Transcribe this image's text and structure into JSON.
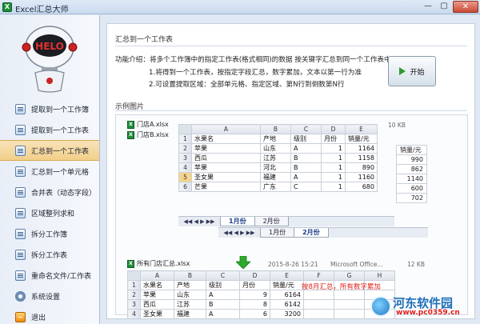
{
  "window": {
    "title": "Excel汇总大师",
    "min_glyph": "—",
    "max_glyph": "▢",
    "close_glyph": "✕"
  },
  "sidebar": {
    "items": [
      {
        "label": "提取到一个工作簿",
        "icon": "workbook-icon"
      },
      {
        "label": "提取到一个工作表",
        "icon": "worksheet-icon"
      },
      {
        "label": "汇总到一个工作表",
        "icon": "summary-sheet-icon",
        "active": true
      },
      {
        "label": "汇总到一个单元格",
        "icon": "cell-icon"
      },
      {
        "label": "合并表（动态字段）",
        "icon": "merge-icon"
      },
      {
        "label": "区域整列求和",
        "icon": "sum-icon"
      },
      {
        "label": "拆分工作簿",
        "icon": "split-workbook-icon"
      },
      {
        "label": "拆分工作表",
        "icon": "split-sheet-icon"
      },
      {
        "label": "重命名文件/工作表",
        "icon": "rename-icon"
      },
      {
        "label": "系统设置",
        "icon": "gear-icon"
      },
      {
        "label": "退出",
        "icon": "exit-icon"
      }
    ]
  },
  "main": {
    "section_title": "汇总到一个工作表",
    "intro": "功能介绍：将多个工作簿中的指定工作表(格式相同)的数据 按关键字汇总到同一个工作表中",
    "bullet1": "1.将得到一个工作表，按指定字段汇总，数字累加，文本以第一行为准",
    "bullet2": "2.可设置提取区域：全部单元格、指定区域、第N行到倒数第N行",
    "start_button": "开始",
    "example_title": "示例图片"
  },
  "example": {
    "file_a": "门店A.xlsx",
    "file_b": "门店B.xlsx",
    "file_a_size": "10 KB",
    "col_letters": [
      "A",
      "B",
      "C",
      "D",
      "E"
    ],
    "sheet_a": {
      "header": [
        "水果名",
        "产地",
        "级别",
        "月份",
        "销量/元"
      ],
      "rows": [
        [
          "苹果",
          "山东",
          "A",
          "1",
          "1164"
        ],
        [
          "西瓜",
          "江苏",
          "B",
          "1",
          "1158"
        ],
        [
          "苹果",
          "河北",
          "B",
          "1",
          "890"
        ],
        [
          "圣女果",
          "福建",
          "A",
          "1",
          "1160"
        ],
        [
          "芒果",
          "广东",
          "C",
          "1",
          "680"
        ]
      ]
    },
    "sheet_b_values": {
      "header": "销量/元",
      "values": [
        "990",
        "862",
        "1140",
        "600",
        "702"
      ]
    },
    "tabs_a": [
      "1月份",
      "2月份"
    ],
    "tabs_b": [
      "1月份",
      "2月份"
    ],
    "summary_file": "所有门店汇总.xlsx",
    "summary_date": "2015-8-26 15:21",
    "summary_type": "Microsoft Office...",
    "summary_size": "12 KB",
    "summary_col_letters": [
      "A",
      "B",
      "C",
      "D",
      "E",
      "F",
      "G",
      "H"
    ],
    "summary": {
      "header": [
        "水果名",
        "产地",
        "级别",
        "月份",
        "销量/元"
      ],
      "rows": [
        [
          "苹果",
          "山东",
          "A",
          "9",
          "6164"
        ],
        [
          "西瓜",
          "江苏",
          "B",
          "8",
          "6142"
        ],
        [
          "圣女果",
          "福建",
          "A",
          "6",
          "3200"
        ]
      ]
    },
    "note": "按8月汇总，所有数字累加"
  },
  "watermark": {
    "brand": "河东软件园",
    "url": "www.pc0359.cn"
  },
  "colors": {
    "accent": "#f2cf8a",
    "green": "#2eaa2e",
    "red": "#e0201a",
    "brand_blue": "#1f6fb8"
  }
}
